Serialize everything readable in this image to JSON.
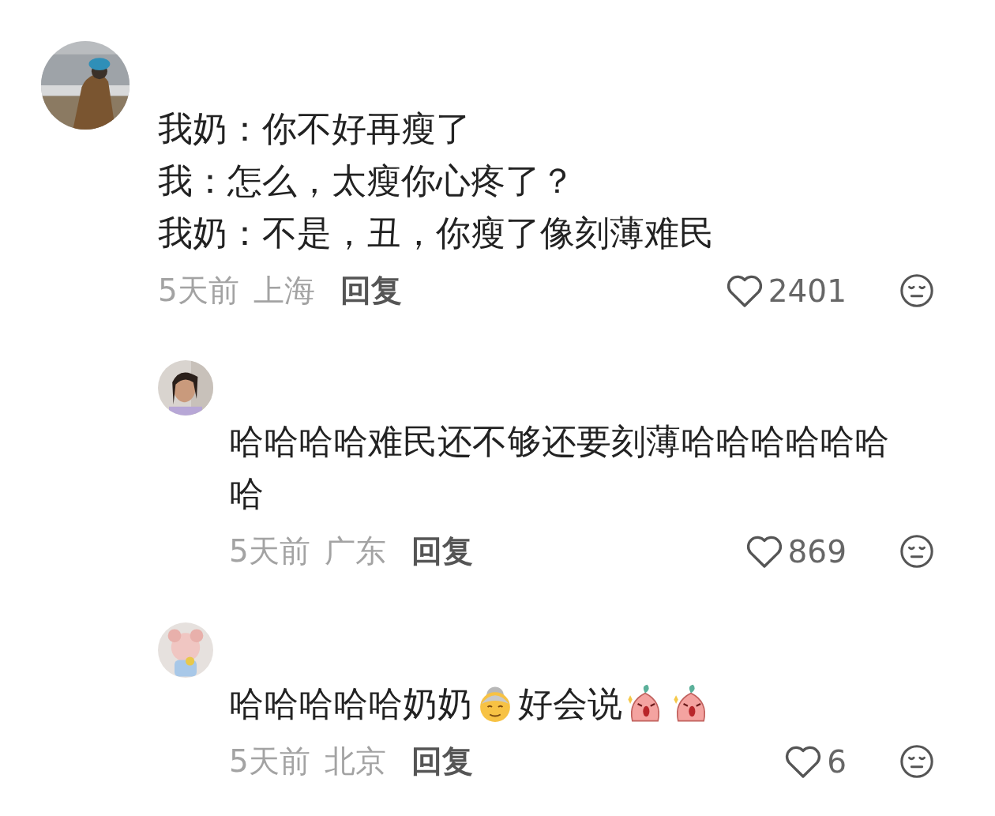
{
  "comments": [
    {
      "lines": [
        "我奶：你不好再瘦了",
        "我：怎么，太瘦你心疼了？",
        "我奶：不是，丑，你瘦了像刻薄难民"
      ],
      "time": "5天前",
      "location": "上海",
      "reply": "回复",
      "likes": "2401",
      "replies": [
        {
          "parts": [
            {
              "kind": "text",
              "text": "哈哈哈哈难民还不够还要刻薄哈哈哈哈哈哈哈"
            }
          ],
          "time": "5天前",
          "location": "广东",
          "reply": "回复",
          "likes": "869"
        },
        {
          "parts": [
            {
              "kind": "text",
              "text": "哈哈哈哈哈奶奶"
            },
            {
              "kind": "grandma"
            },
            {
              "kind": "text",
              "text": "好会说"
            },
            {
              "kind": "sticker"
            },
            {
              "kind": "sticker"
            }
          ],
          "time": "5天前",
          "location": "北京",
          "reply": "回复",
          "likes": "6"
        }
      ]
    }
  ]
}
